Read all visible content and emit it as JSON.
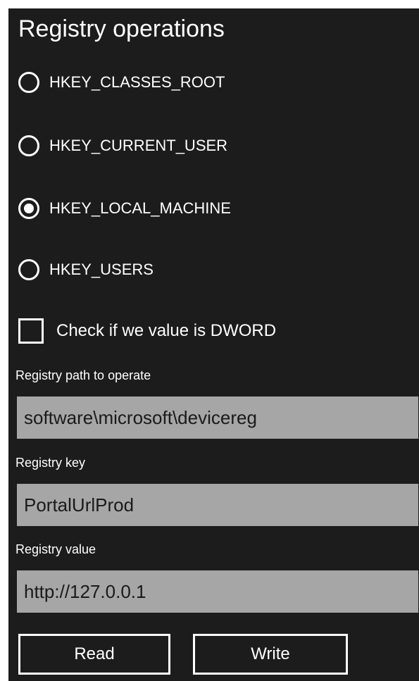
{
  "page": {
    "title": "Registry operations"
  },
  "hives": {
    "options": [
      {
        "label": "HKEY_CLASSES_ROOT",
        "selected": false
      },
      {
        "label": "HKEY_CURRENT_USER",
        "selected": false
      },
      {
        "label": "HKEY_LOCAL_MACHINE",
        "selected": true
      },
      {
        "label": "HKEY_USERS",
        "selected": false
      }
    ]
  },
  "dword_checkbox": {
    "label": "Check if we value is DWORD",
    "checked": false
  },
  "fields": {
    "path": {
      "label": "Registry path to operate",
      "value": "software\\microsoft\\devicereg"
    },
    "key": {
      "label": "Registry key",
      "value": "PortalUrlProd"
    },
    "value": {
      "label": "Registry value",
      "value": "http://127.0.0.1"
    }
  },
  "buttons": {
    "read_label": "Read",
    "write_label": "Write"
  },
  "colors": {
    "background": "#1c1c1c",
    "input_background": "#a6a6a6",
    "foreground": "#ffffff"
  }
}
